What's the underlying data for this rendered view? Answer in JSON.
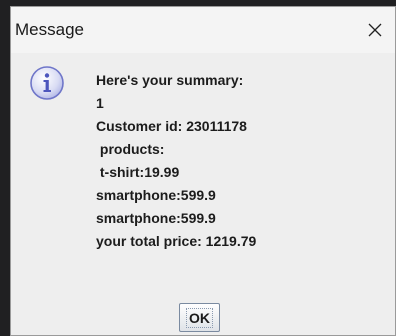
{
  "window": {
    "title": "Message",
    "close_icon": "close-icon"
  },
  "message": {
    "icon": "information-icon",
    "icon_color": "#5b63c7",
    "lines": [
      "Here's your summary:",
      "1",
      "Customer id: 23011178",
      " products:",
      " t-shirt:19.99",
      "smartphone:599.9",
      "smartphone:599.9",
      "your total price: 1219.79"
    ]
  },
  "buttons": {
    "ok_label": "OK"
  }
}
